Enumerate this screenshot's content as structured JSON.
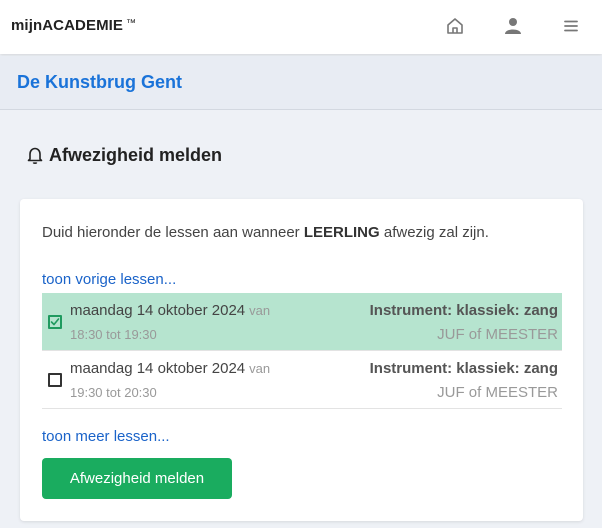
{
  "header": {
    "brand": "mijnACADEMIE",
    "trademark": "™",
    "icons": [
      "home-icon",
      "user-icon",
      "menu-icon"
    ]
  },
  "school": {
    "name": "De Kunstbrug Gent"
  },
  "page": {
    "title": "Afwezigheid melden",
    "title_icon": "bell-icon"
  },
  "card": {
    "intro_before": "Duid hieronder de lessen aan wanneer ",
    "intro_student": "LEERLING",
    "intro_after": " afwezig zal zijn.",
    "previous_link": "toon vorige lessen...",
    "more_link": "toon meer lessen...",
    "submit_label": "Afwezigheid melden",
    "lessons": [
      {
        "date": "maandag 14 oktober 2024",
        "van": "van",
        "time": "18:30 tot 19:30",
        "instrument": "Instrument: klassiek: zang",
        "teacher": "JUF of MEESTER",
        "selected": true
      },
      {
        "date": "maandag 14 oktober 2024",
        "van": "van",
        "time": "19:30 tot 20:30",
        "instrument": "Instrument: klassiek: zang",
        "teacher": "JUF of MEESTER",
        "selected": false
      }
    ]
  },
  "colors": {
    "accent_blue": "#1a73d9",
    "link_blue": "#1a63c9",
    "selected_row": "#b6e4cf",
    "button_green": "#1aac5f"
  }
}
